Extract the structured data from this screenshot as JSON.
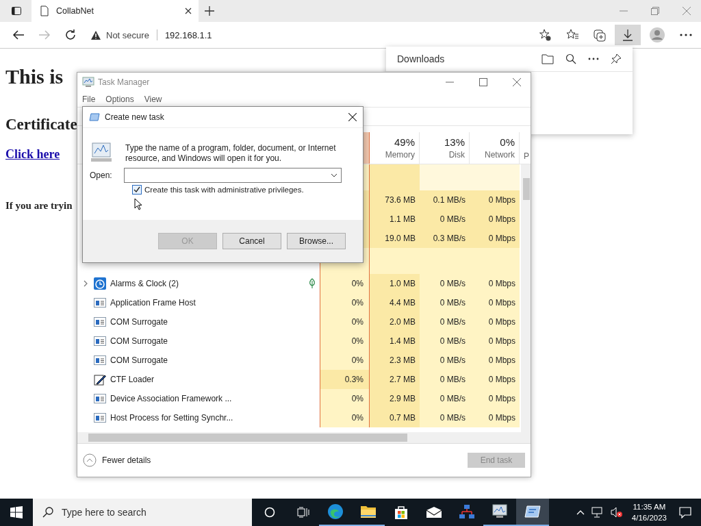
{
  "browser": {
    "tab_title": "CollabNet",
    "security": "Not secure",
    "url": "192.168.1.1"
  },
  "page": {
    "heading": "This is",
    "subheading": "Certificate",
    "link": "Click here",
    "text": "If you are tryin"
  },
  "downloads": {
    "title": "Downloads"
  },
  "task_manager": {
    "title": "Task Manager",
    "menu": [
      "File",
      "Options",
      "View"
    ],
    "columns": [
      {
        "value": "49%",
        "label": "Memory"
      },
      {
        "value": "13%",
        "label": "Disk"
      },
      {
        "value": "0%",
        "label": "Network"
      }
    ],
    "column_5": "P",
    "app_rows": [
      {
        "memory": "73.6 MB",
        "disk": "0.1 MB/s",
        "network": "0 Mbps"
      },
      {
        "memory": "1.1 MB",
        "disk": "0 MB/s",
        "network": "0 Mbps"
      },
      {
        "memory": "19.0 MB",
        "disk": "0.3 MB/s",
        "network": "0 Mbps"
      }
    ],
    "processes": [
      {
        "name": "Alarms & Clock (2)",
        "kind": "clock",
        "expandable": true,
        "eco": true,
        "cpu": "0%",
        "memory": "1.0 MB",
        "disk": "0 MB/s",
        "network": "0 Mbps"
      },
      {
        "name": "Application Frame Host",
        "kind": "window",
        "expandable": false,
        "eco": false,
        "cpu": "0%",
        "memory": "4.4 MB",
        "disk": "0 MB/s",
        "network": "0 Mbps"
      },
      {
        "name": "COM Surrogate",
        "kind": "window",
        "expandable": false,
        "eco": false,
        "cpu": "0%",
        "memory": "2.0 MB",
        "disk": "0 MB/s",
        "network": "0 Mbps"
      },
      {
        "name": "COM Surrogate",
        "kind": "window",
        "expandable": false,
        "eco": false,
        "cpu": "0%",
        "memory": "1.4 MB",
        "disk": "0 MB/s",
        "network": "0 Mbps"
      },
      {
        "name": "COM Surrogate",
        "kind": "window",
        "expandable": false,
        "eco": false,
        "cpu": "0%",
        "memory": "2.3 MB",
        "disk": "0 MB/s",
        "network": "0 Mbps"
      },
      {
        "name": "CTF Loader",
        "kind": "pen",
        "expandable": false,
        "eco": false,
        "cpu": "0.3%",
        "memory": "2.7 MB",
        "disk": "0 MB/s",
        "network": "0 Mbps"
      },
      {
        "name": "Device Association Framework ...",
        "kind": "window",
        "expandable": false,
        "eco": false,
        "cpu": "0%",
        "memory": "2.9 MB",
        "disk": "0 MB/s",
        "network": "0 Mbps"
      },
      {
        "name": "Host Process for Setting Synchr...",
        "kind": "window",
        "expandable": false,
        "eco": false,
        "cpu": "0%",
        "memory": "0.7 MB",
        "disk": "0 MB/s",
        "network": "0 Mbps"
      }
    ],
    "fewer_details": "Fewer details",
    "end_task": {
      "label": "End task",
      "disabled": true
    }
  },
  "dialog": {
    "title": "Create new task",
    "description": "Type the name of a program, folder, document, or Internet resource, and Windows will open it for you.",
    "open_label": "Open:",
    "admin_checkbox": {
      "label": "Create this task with administrative privileges.",
      "checked": true
    },
    "buttons": [
      {
        "label": "OK",
        "disabled": true
      },
      {
        "label": "Cancel",
        "disabled": false
      },
      {
        "label": "Browse...",
        "disabled": false
      }
    ]
  },
  "taskbar": {
    "search_placeholder": "Type here to search",
    "time": "11:35 AM",
    "date": "4/16/2023",
    "apps": [
      {
        "kind": "edge",
        "running": true,
        "selected": false
      },
      {
        "kind": "folder",
        "running": true,
        "selected": false
      },
      {
        "kind": "store",
        "running": false,
        "selected": false
      },
      {
        "kind": "mail",
        "running": false,
        "selected": false
      },
      {
        "kind": "network",
        "running": false,
        "selected": false
      },
      {
        "kind": "monitor",
        "running": true,
        "selected": false
      },
      {
        "kind": "run",
        "running": true,
        "selected": true
      }
    ]
  }
}
